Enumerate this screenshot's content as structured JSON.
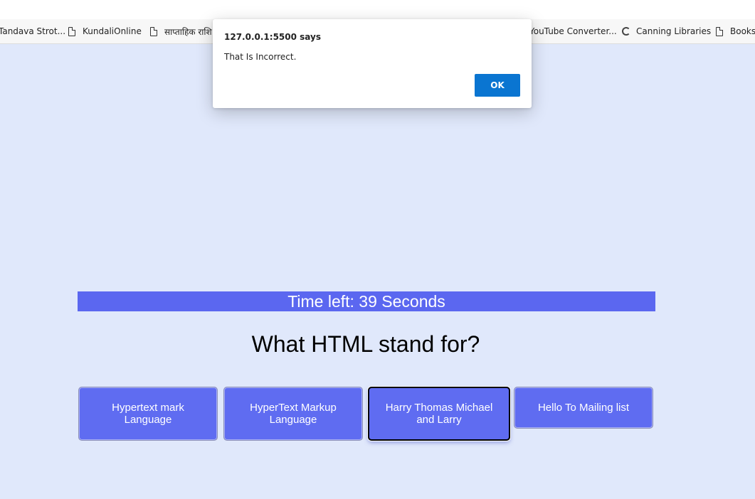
{
  "bookmarks": [
    {
      "label": "Tandava Strot...",
      "icon": "none"
    },
    {
      "label": "KundaliOnline",
      "icon": "document-icon"
    },
    {
      "label": "साप्ताहिक राशि",
      "icon": "document-icon"
    },
    {
      "label": "YouTube Converter...",
      "icon": "none"
    },
    {
      "label": "Canning Libraries",
      "icon": "globe-icon"
    },
    {
      "label": "Books",
      "icon": "document-icon"
    }
  ],
  "dialog": {
    "title": "127.0.0.1:5500 says",
    "message": "That Is Incorrect.",
    "ok_label": "OK"
  },
  "quiz": {
    "timer_text": "Time left: 39 Seconds",
    "question": "What HTML stand for?",
    "answers": [
      "Hypertext mark Language",
      "HyperText Markup Language",
      "Harry Thomas Michael and Larry",
      "Hello To Mailing list"
    ]
  },
  "colors": {
    "page_background": "#e0e8fb",
    "timer_bar": "#5b67f0",
    "answer_button": "#5f6cf1",
    "dialog_ok": "#0a75d1"
  }
}
